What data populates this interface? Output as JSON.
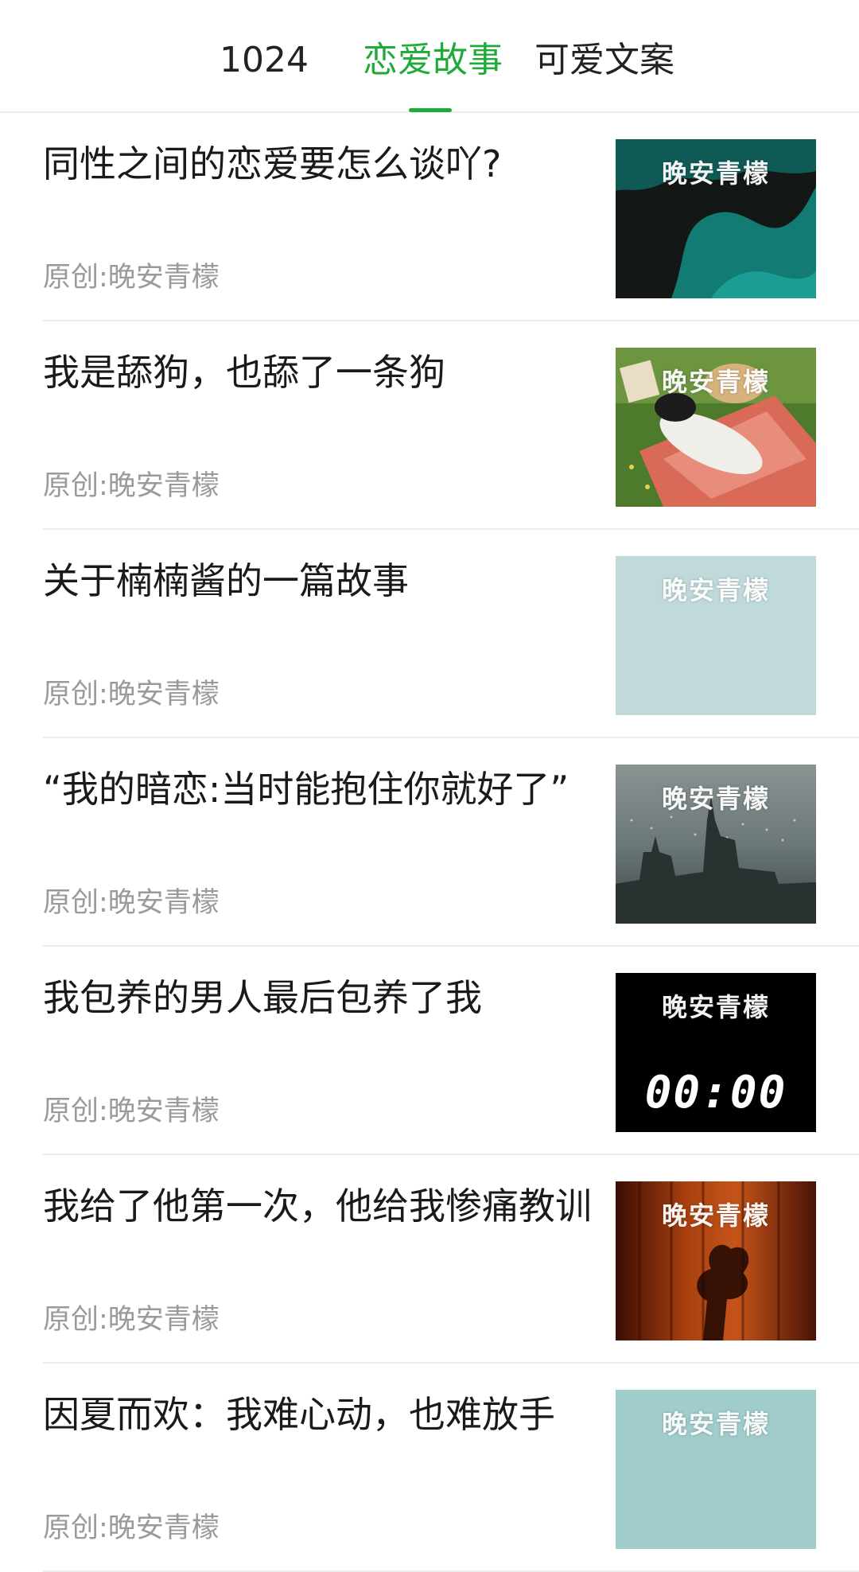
{
  "tabs": [
    {
      "label": "1024",
      "active": false
    },
    {
      "label": "恋爱故事",
      "active": true
    },
    {
      "label": "可爱文案",
      "active": false
    }
  ],
  "accent_color": "#1fab3a",
  "articles": [
    {
      "title": "同性之间的恋爱要怎么谈吖?",
      "meta": "原创:晚安青檬",
      "thumb_watermark": "晚安青檬",
      "thumb_style": "dark-teal-abstract"
    },
    {
      "title": "我是舔狗，也舔了一条狗",
      "meta": "原创:晚安青檬",
      "thumb_watermark": "晚安青檬",
      "thumb_style": "girl-on-grass-picnic"
    },
    {
      "title": "关于楠楠酱的一篇故事",
      "meta": "原创:晚安青檬",
      "thumb_watermark": "晚安青檬",
      "thumb_style": "plain-light-blue"
    },
    {
      "title": "“我的暗恋:当时能抱住你就好了”",
      "meta": "原创:晚安青檬",
      "thumb_watermark": "晚安青檬",
      "thumb_style": "city-night-skyline"
    },
    {
      "title": "我包养的男人最后包养了我",
      "meta": "原创:晚安青檬",
      "thumb_watermark": "晚安青檬",
      "thumb_style": "black-clock",
      "thumb_clock": "00:00"
    },
    {
      "title": "我给了他第一次，他给我惨痛教训",
      "meta": "原创:晚安青檬",
      "thumb_watermark": "晚安青檬",
      "thumb_style": "orange-curtain-shadow"
    },
    {
      "title": "因夏而欢：我难心动，也难放手",
      "meta": "原创:晚安青檬",
      "thumb_watermark": "晚安青檬",
      "thumb_style": "plain-sage-teal"
    }
  ]
}
